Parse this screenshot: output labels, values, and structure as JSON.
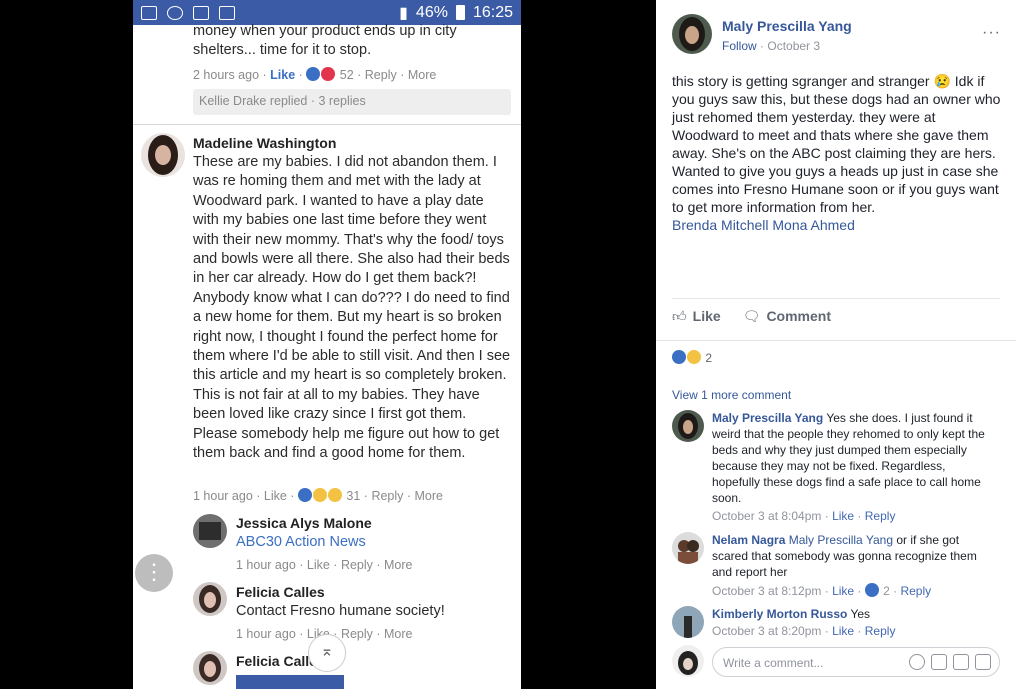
{
  "phone": {
    "status": {
      "battery": "46%",
      "time": "16:25"
    },
    "prev_comment": {
      "text": "money when your product ends up in city shelters... time for it to stop.",
      "time": "2 hours ago",
      "like": "Like",
      "count": "52",
      "reply": "Reply",
      "more": "More",
      "replied": "Kellie Drake replied · 3 replies"
    },
    "madeline": {
      "name": "Madeline Washington",
      "text": "These are my babies. I did not abandon them. I was re homing them and met with the lady at Woodward park. I wanted to have a play date with my babies one last time before they went with their new mommy. That's why the food/ toys and bowls were all there. She also had their beds in her car already. How do I get them back?! Anybody know what I can do??? I do need to find a new home for them. But my heart is so broken right now, I thought I found the perfect home for them where I'd be able to still visit. And then I see this article and my heart is so completely broken. This is not fair at all to my babies. They have been loved like crazy since I first got them. Please somebody help me figure out how to get them back and find a good home for them.",
      "time": "1 hour ago",
      "like": "Like",
      "count": "31",
      "reply": "Reply",
      "more": "More"
    },
    "replies": [
      {
        "name": "Jessica Alys Malone",
        "text": "ABC30 Action News",
        "time": "1 hour ago",
        "like": "Like",
        "reply": "Reply",
        "more": "More"
      },
      {
        "name": "Felicia Calles",
        "text": "Contact Fresno humane society!",
        "time": "1 hour ago",
        "like": "Like",
        "reply": "Reply",
        "more": "More"
      },
      {
        "name": "Felicia Calles"
      }
    ],
    "dots": "⋮",
    "up": "⌅"
  },
  "post": {
    "author": "Maly Prescilla Yang",
    "follow": "Follow",
    "date": "October 3",
    "more": "···",
    "body": "this story is getting sgranger and stranger 😢 Idk if you guys saw this, but these dogs had an owner who just rehomed them yesterday. they were at Woodward to meet and thats where she gave them away. She's on the ABC post claiming they are hers. Wanted to give you guys a heads up just in case she comes into Fresno Humane soon or if you guys want to get more information from her.",
    "tags": "Brenda Mitchell Mona Ahmed",
    "like_label": "Like",
    "comment_label": "Comment",
    "reaction_count": "2",
    "view_more": "View 1 more comment",
    "comments": [
      {
        "name": "Maly Prescilla Yang",
        "text": "Yes she does. I just found it weird that the people they rehomed to only kept the beds and why they just dumped them especially because they may not be fixed. Regardless, hopefully these dogs find a safe place to call home soon.",
        "time": "October 3 at 8:04pm",
        "like": "Like",
        "reply": "Reply"
      },
      {
        "name": "Nelam Nagra",
        "tag": "Maly Prescilla Yang",
        "text": "or if she got scared that somebody was gonna recognize them and report her",
        "time": "October 3 at 8:12pm",
        "like": "Like",
        "count": "2",
        "reply": "Reply"
      },
      {
        "name": "Kimberly Morton Russo",
        "text": "Yes",
        "time": "October 3 at 8:20pm",
        "like": "Like",
        "reply": "Reply"
      }
    ],
    "write_placeholder": "Write a comment..."
  }
}
